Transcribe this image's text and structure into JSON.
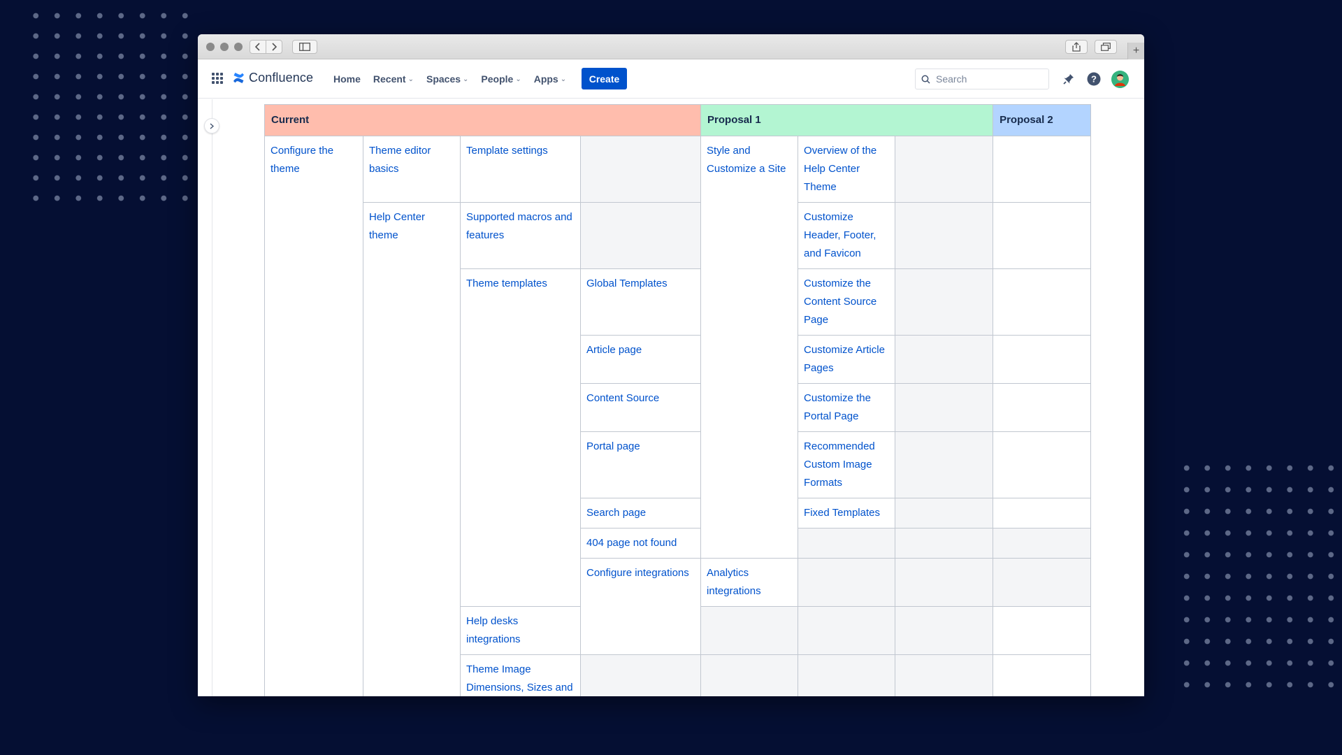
{
  "navbar": {
    "logo_text": "Confluence",
    "items": [
      {
        "label": "Home",
        "dropdown": false
      },
      {
        "label": "Recent",
        "dropdown": true
      },
      {
        "label": "Spaces",
        "dropdown": true
      },
      {
        "label": "People",
        "dropdown": true
      },
      {
        "label": "Apps",
        "dropdown": true
      }
    ],
    "create_label": "Create",
    "search_placeholder": "Search",
    "icons": [
      "notification-icon",
      "help-icon",
      "avatar"
    ]
  },
  "table": {
    "headers": {
      "current": "Current",
      "proposal1": "Proposal 1",
      "proposal2": "Proposal 2"
    },
    "current": {
      "configure_theme": "Configure the theme",
      "theme_editor_basics": "Theme editor basics",
      "template_settings": "Template settings",
      "help_center_theme": "Help Center theme",
      "supported_macros": "Supported macros and features",
      "theme_templates": "Theme templates",
      "global_templates": "Global Templates",
      "article_page": "Article page",
      "content_source": "Content Source",
      "portal_page": "Portal page",
      "search_page": "Search page",
      "page_not_found": "404 page not found",
      "configure_integrations": "Configure integrations",
      "analytics_integrations": "Analytics integrations",
      "help_desks_integrations": "Help desks integrations",
      "theme_image_dimensions": "Theme Image Dimensions, Sizes and Formats"
    },
    "proposal1": {
      "style_customize": "Style and Customize a Site",
      "items": [
        "Overview of the Help Center Theme",
        "Customize Header, Footer, and Favicon",
        "Customize the Content Source Page",
        "Customize Article Pages",
        "Customize the Portal Page",
        "Recommended Custom Image Formats",
        "Fixed Templates"
      ]
    }
  },
  "colors": {
    "current_header": "#ffbdad",
    "proposal1_header": "#b3f5d2",
    "proposal2_header": "#b3d4ff",
    "link": "#0052cc",
    "create_button": "#0052cc"
  }
}
